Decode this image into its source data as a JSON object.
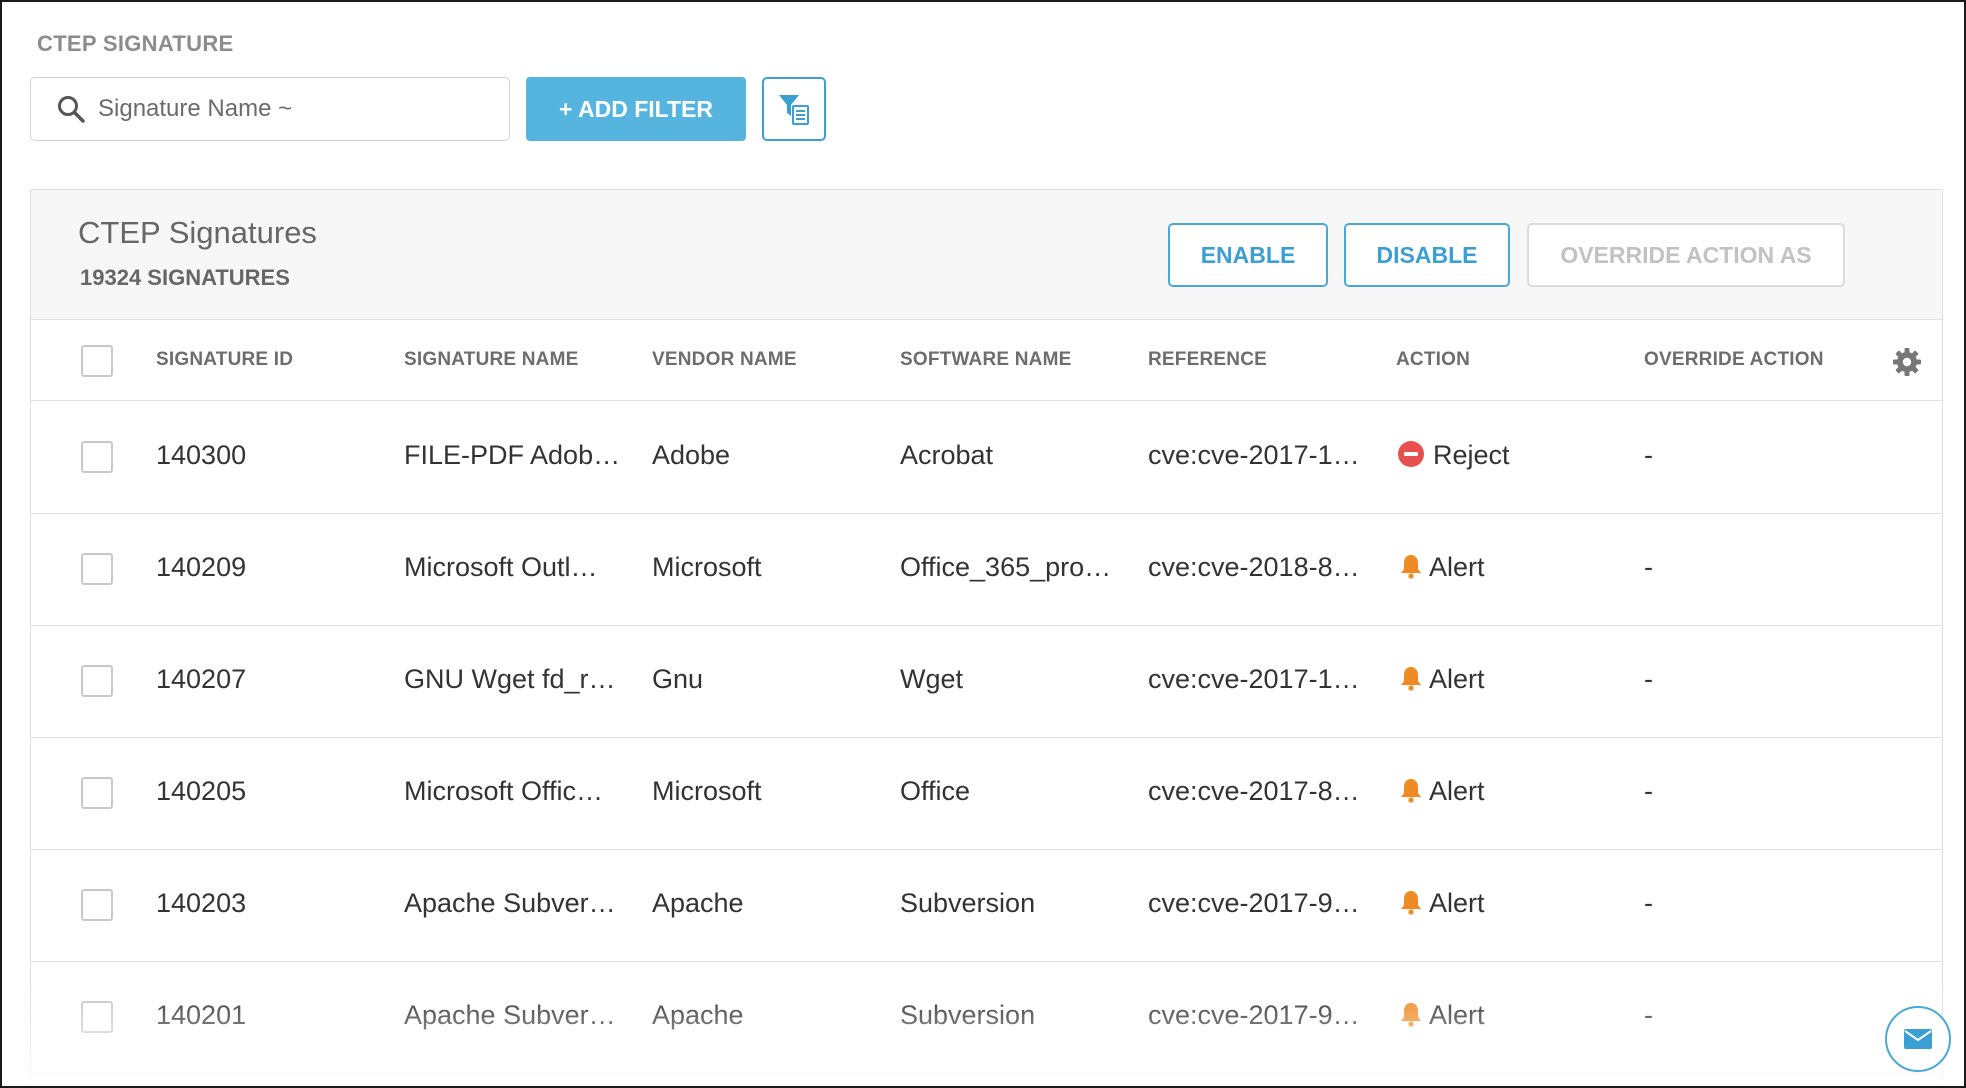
{
  "page": {
    "label": "CTEP SIGNATURE"
  },
  "search": {
    "placeholder": "Signature Name ~",
    "value": "",
    "icon": "search-icon"
  },
  "toolbar": {
    "add_filter_label": "+ ADD FILTER",
    "filter_list_icon": "filter-list-icon"
  },
  "panel": {
    "title": "CTEP Signatures",
    "count": "19324 SIGNATURES",
    "enable_label": "ENABLE",
    "disable_label": "DISABLE",
    "override_label": "OVERRIDE ACTION AS"
  },
  "table": {
    "columns": [
      "SIGNATURE ID",
      "SIGNATURE NAME",
      "VENDOR NAME",
      "SOFTWARE NAME",
      "REFERENCE",
      "ACTION",
      "OVERRIDE ACTION"
    ],
    "rows": [
      {
        "id": "140300",
        "name": "FILE-PDF Adob…",
        "vendor": "Adobe",
        "software": "Acrobat",
        "reference": "cve:cve-2017-1…",
        "action": "Reject",
        "action_icon": "reject-icon",
        "override": "-"
      },
      {
        "id": "140209",
        "name": "Microsoft Outl…",
        "vendor": "Microsoft",
        "software": "Office_365_pro…",
        "reference": "cve:cve-2018-8…",
        "action": "Alert",
        "action_icon": "bell-icon",
        "override": "-"
      },
      {
        "id": "140207",
        "name": "GNU Wget fd_r…",
        "vendor": "Gnu",
        "software": "Wget",
        "reference": "cve:cve-2017-1…",
        "action": "Alert",
        "action_icon": "bell-icon",
        "override": "-"
      },
      {
        "id": "140205",
        "name": "Microsoft Offic…",
        "vendor": "Microsoft",
        "software": "Office",
        "reference": "cve:cve-2017-8…",
        "action": "Alert",
        "action_icon": "bell-icon",
        "override": "-"
      },
      {
        "id": "140203",
        "name": "Apache Subver…",
        "vendor": "Apache",
        "software": "Subversion",
        "reference": "cve:cve-2017-9…",
        "action": "Alert",
        "action_icon": "bell-icon",
        "override": "-"
      },
      {
        "id": "140201",
        "name": "Apache Subver…",
        "vendor": "Apache",
        "software": "Subversion",
        "reference": "cve:cve-2017-9…",
        "action": "Alert",
        "action_icon": "bell-icon",
        "override": "-"
      }
    ]
  },
  "colors": {
    "accent": "#56b5de",
    "reject": "#e8504f",
    "alert": "#f08a24"
  },
  "floating": {
    "mail_icon": "mail-icon"
  }
}
